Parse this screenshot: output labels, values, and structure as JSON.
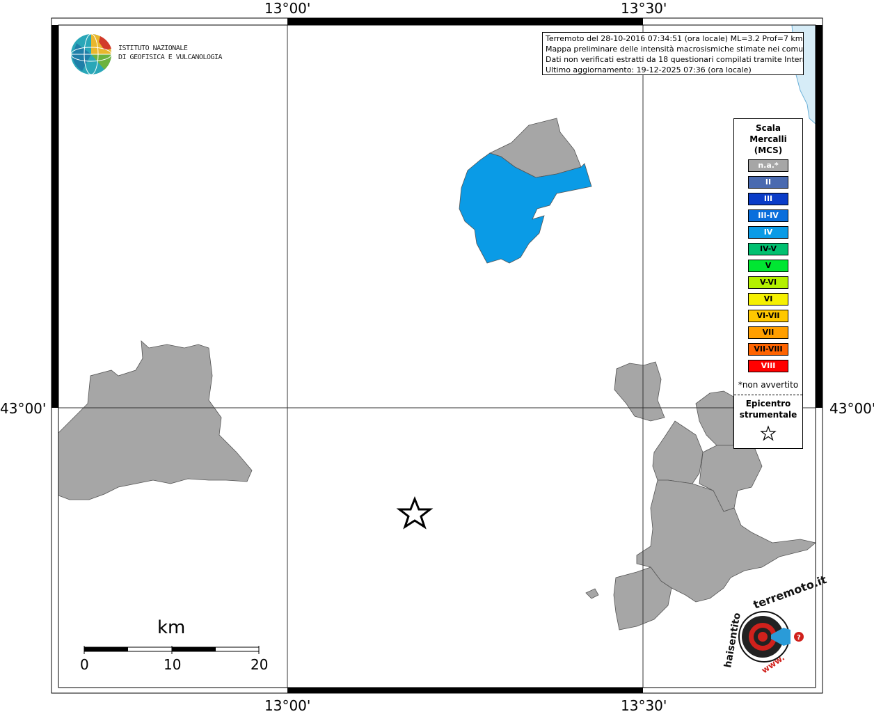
{
  "coords": {
    "top_left": "13°00'",
    "top_right": "13°30'",
    "bottom_left": "13°00'",
    "bottom_right": "13°30'",
    "left_lat": "43°00'",
    "right_lat": "43°00'"
  },
  "info": {
    "line1": "Terremoto del 28-10-2016 07:34:51 (ora locale) ML=3.2 Prof=7 km",
    "line2": "Mappa preliminare delle intensità macrosismiche stimate nei comuni",
    "line3": "Dati non verificati estratti da 18 questionari compilati tramite Internet.",
    "line4": "Ultimo aggiornamento: 19-12-2025 07:36 (ora locale)"
  },
  "logo": {
    "line1": "ISTITUTO NAZIONALE",
    "line2": "DI GEOFISICA E VULCANOLOGIA"
  },
  "legend": {
    "title1": "Scala",
    "title2": "Mercalli",
    "title3": "(MCS)",
    "items": [
      {
        "label": "n.a.*",
        "color": "#a6a6a6",
        "text_color": "#ffffff"
      },
      {
        "label": "II",
        "color": "#4a6ab0",
        "text_color": "#ffffff"
      },
      {
        "label": "III",
        "color": "#0a3cc8",
        "text_color": "#ffffff"
      },
      {
        "label": "III-IV",
        "color": "#0a6edc",
        "text_color": "#ffffff"
      },
      {
        "label": "IV",
        "color": "#0a9be6",
        "text_color": "#ffffff"
      },
      {
        "label": "IV-V",
        "color": "#00c070",
        "text_color": "#000000"
      },
      {
        "label": "V",
        "color": "#00e632",
        "text_color": "#000000"
      },
      {
        "label": "V-VI",
        "color": "#b4f000",
        "text_color": "#000000"
      },
      {
        "label": "VI",
        "color": "#f5f000",
        "text_color": "#000000"
      },
      {
        "label": "VI-VII",
        "color": "#ffc800",
        "text_color": "#000000"
      },
      {
        "label": "VII",
        "color": "#ff9f00",
        "text_color": "#000000"
      },
      {
        "label": "VII-VIII",
        "color": "#ff6400",
        "text_color": "#000000"
      },
      {
        "label": "VIII",
        "color": "#ff0000",
        "text_color": "#ffffff"
      }
    ],
    "note": "*non avvertito",
    "epicenter1": "Epicentro",
    "epicenter2": "strumentale"
  },
  "scale": {
    "unit": "km",
    "ticks": [
      "0",
      "10",
      "20"
    ]
  },
  "colors": {
    "na": "#a6a6a6",
    "intensity_iv": "#0a9be6",
    "sea": "#d6ecf7"
  },
  "watermark": "www.haisentitoilterremoto.it"
}
